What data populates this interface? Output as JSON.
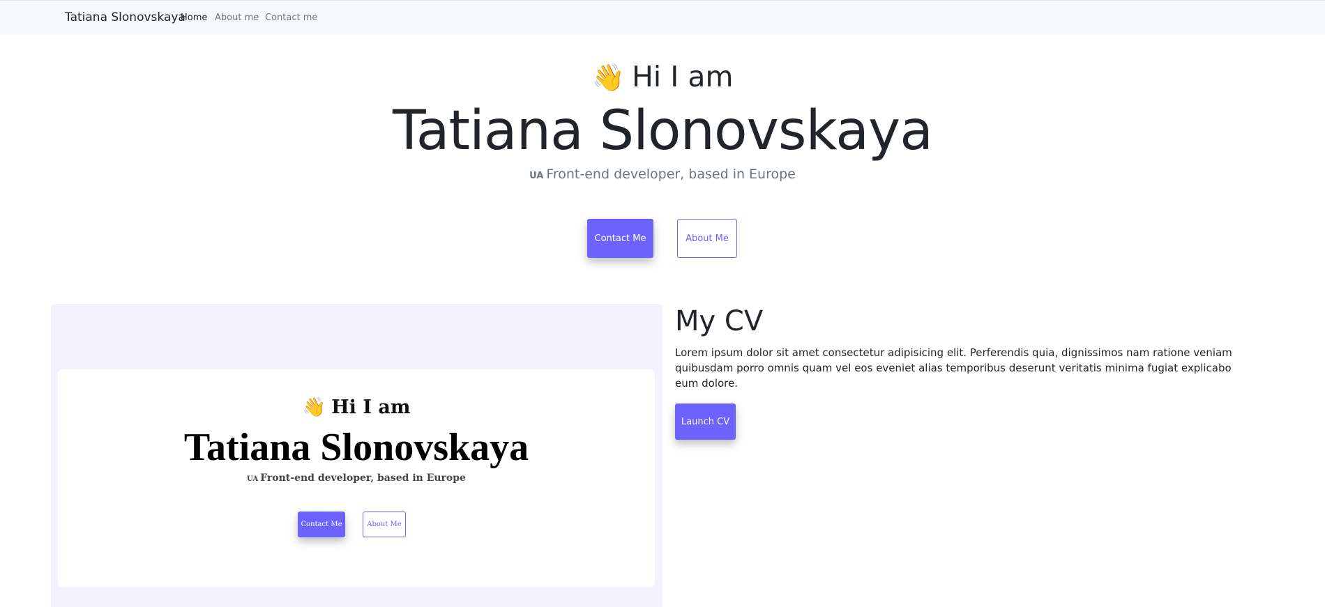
{
  "navbar": {
    "brand": "Tatiana Slonovskaya",
    "links": [
      {
        "label": "Home",
        "active": true
      },
      {
        "label": "About me",
        "active": false
      },
      {
        "label": "Contact me",
        "active": false
      }
    ]
  },
  "hero": {
    "wave_emoji": "👋",
    "greeting": "Hi I am",
    "name": "Tatiana Slonovskaya",
    "flag": "UA",
    "subtitle": "Front-end developer, based in Europe",
    "contact_button": "Contact Me",
    "about_button": "About Me"
  },
  "preview": {
    "wave_emoji": "👋",
    "greeting": "Hi I am",
    "name": "Tatiana Slonovskaya",
    "flag": "UA",
    "subtitle": "Front-end developer, based in Europe",
    "contact_button": "Contact Me",
    "about_button": "About Me"
  },
  "cv": {
    "title": "My CV",
    "description": "Lorem ipsum dolor sit amet consectetur adipisicing elit. Perferendis quia, dignissimos nam ratione veniam quibusdam porro omnis quam vel eos eveniet alias temporibus deserunt veritatis minima fugiat explicabo eum dolore.",
    "launch_button": "Launch CV"
  },
  "colors": {
    "accent": "#6c63ff",
    "navbar_bg": "#f8f9fa",
    "preview_bg": "#f3f1fe"
  }
}
